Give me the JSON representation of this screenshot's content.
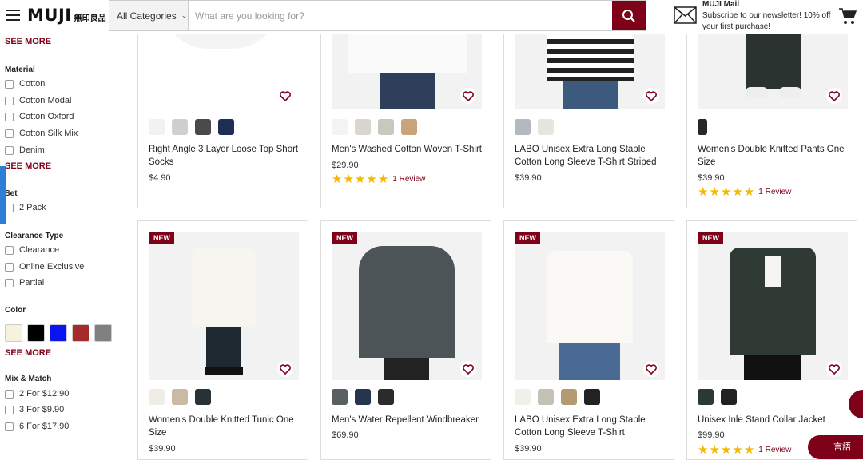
{
  "header": {
    "logo": "MUJI",
    "logo_jp": "無印良品",
    "category": "All Categories",
    "search_placeholder": "What are you looking for?",
    "mail_title": "MUJI Mail",
    "mail_text": "Subscribe to our newsletter! 10% off your first purchase!"
  },
  "sidebar": {
    "see_more_1": "SEE MORE",
    "material_title": "Material",
    "material": [
      "Cotton",
      "Cotton Modal",
      "Cotton Oxford",
      "Cotton Silk Mix",
      "Denim"
    ],
    "see_more_2": "SEE MORE",
    "set_title": "Set",
    "set": [
      "2 Pack"
    ],
    "clearance_title": "Clearance Type",
    "clearance": [
      "Clearance",
      "Online Exclusive",
      "Partial"
    ],
    "color_title": "Color",
    "colors": [
      "#f5f3dc",
      "#000000",
      "#0a14f0",
      "#a52a2a",
      "#808080"
    ],
    "see_more_3": "SEE MORE",
    "mix_title": "Mix & Match",
    "mix": [
      "2 For $12.90",
      "3 For $9.90",
      "6 For $17.90"
    ]
  },
  "products_row1": [
    {
      "name": "Right Angle 3 Layer Loose Top Short Socks",
      "price": "$4.90",
      "colors": [
        "#f2f2f2",
        "#cfcfcf",
        "#4a4a4a",
        "#1e2f55"
      ],
      "stars": 0,
      "review": ""
    },
    {
      "name": "Men's Washed Cotton Woven T-Shirt",
      "price": "$29.90",
      "colors": [
        "#f3f3f3",
        "#d9d6cf",
        "#c9c8bd",
        "#c9a37a"
      ],
      "stars": 5,
      "review": "1 Review"
    },
    {
      "name": "LABO Unisex Extra Long Staple Cotton Long Sleeve T-Shirt Striped",
      "price": "$39.90",
      "colors": [
        "#b4b8c0",
        "#e6e6e0"
      ],
      "stars": 0,
      "review": ""
    },
    {
      "name": "Women's Double Knitted Pants One Size",
      "price": "$39.90",
      "colors": [
        "#23282c"
      ],
      "stars": 5,
      "review": "1 Review"
    }
  ],
  "products_row2": [
    {
      "badge": "NEW",
      "name": "Women's Double Knitted Tunic One Size",
      "price": "$39.90",
      "colors": [
        "#f0ede6",
        "#c9b9a5",
        "#263236"
      ]
    },
    {
      "badge": "NEW",
      "name": "Men's Water Repellent Windbreaker",
      "price": "$69.90",
      "colors": [
        "#5a5f62",
        "#26354d",
        "#2b2b2b"
      ]
    },
    {
      "badge": "NEW",
      "name": "LABO Unisex Extra Long Staple Cotton Long Sleeve T-Shirt",
      "price": "$39.90",
      "colors": [
        "#f2f0ea",
        "#c4c2b4",
        "#b39a73",
        "#222222"
      ]
    },
    {
      "badge": "NEW",
      "name": "Unisex Inle Stand Collar Jacket",
      "price": "$99.90",
      "colors": [
        "#2d3a33",
        "#1f2220"
      ],
      "review": "1 Review"
    }
  ],
  "lang_button": "言語"
}
